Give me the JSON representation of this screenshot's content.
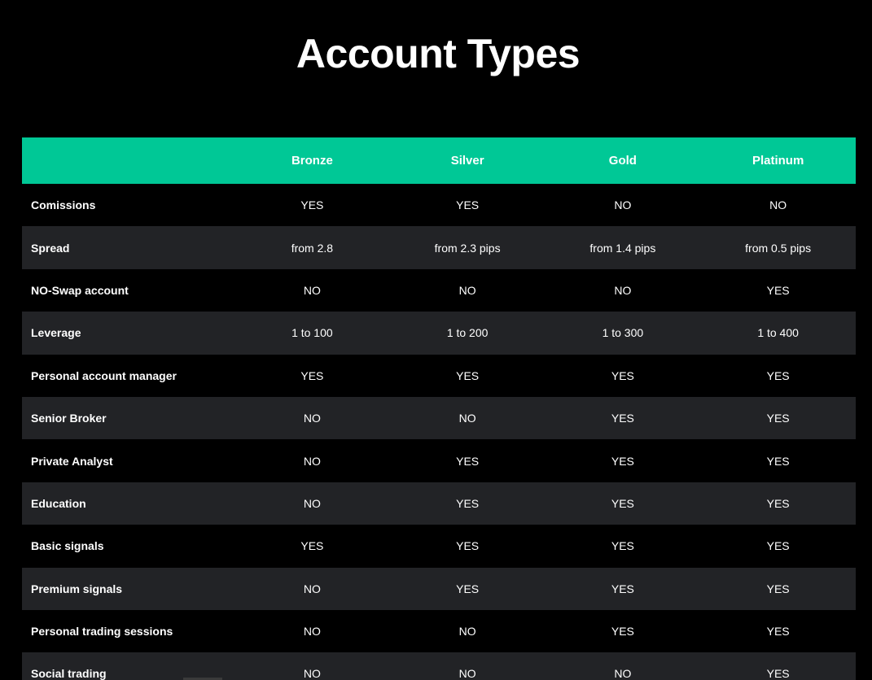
{
  "page": {
    "title": "Account Types"
  },
  "table": {
    "headers": [
      "",
      "Bronze",
      "Silver",
      "Gold",
      "Platinum"
    ],
    "rows": [
      {
        "label": "Comissions",
        "values": [
          "YES",
          "YES",
          "NO",
          "NO"
        ]
      },
      {
        "label": "Spread",
        "values": [
          "from 2.8",
          "from 2.3 pips",
          "from 1.4 pips",
          "from 0.5 pips"
        ]
      },
      {
        "label": "NO-Swap account",
        "values": [
          "NO",
          "NO",
          "NO",
          "YES"
        ]
      },
      {
        "label": "Leverage",
        "values": [
          "1 to 100",
          "1 to 200",
          "1 to 300",
          "1 to 400"
        ]
      },
      {
        "label": "Personal account manager",
        "values": [
          "YES",
          "YES",
          "YES",
          "YES"
        ]
      },
      {
        "label": "Senior Broker",
        "values": [
          "NO",
          "NO",
          "YES",
          "YES"
        ]
      },
      {
        "label": "Private Analyst",
        "values": [
          "NO",
          "YES",
          "YES",
          "YES"
        ]
      },
      {
        "label": "Education",
        "values": [
          "NO",
          "YES",
          "YES",
          "YES"
        ]
      },
      {
        "label": "Basic signals",
        "values": [
          "YES",
          "YES",
          "YES",
          "YES"
        ]
      },
      {
        "label": "Premium signals",
        "values": [
          "NO",
          "YES",
          "YES",
          "YES"
        ]
      },
      {
        "label": "Personal trading sessions",
        "values": [
          "NO",
          "NO",
          "YES",
          "YES"
        ]
      },
      {
        "label": "Social trading",
        "values": [
          "NO",
          "NO",
          "NO",
          "YES"
        ]
      }
    ]
  },
  "colors": {
    "header_bg": "#00c896",
    "row_alt_bg": "#222326",
    "page_bg": "#000000",
    "text": "#ffffff"
  }
}
